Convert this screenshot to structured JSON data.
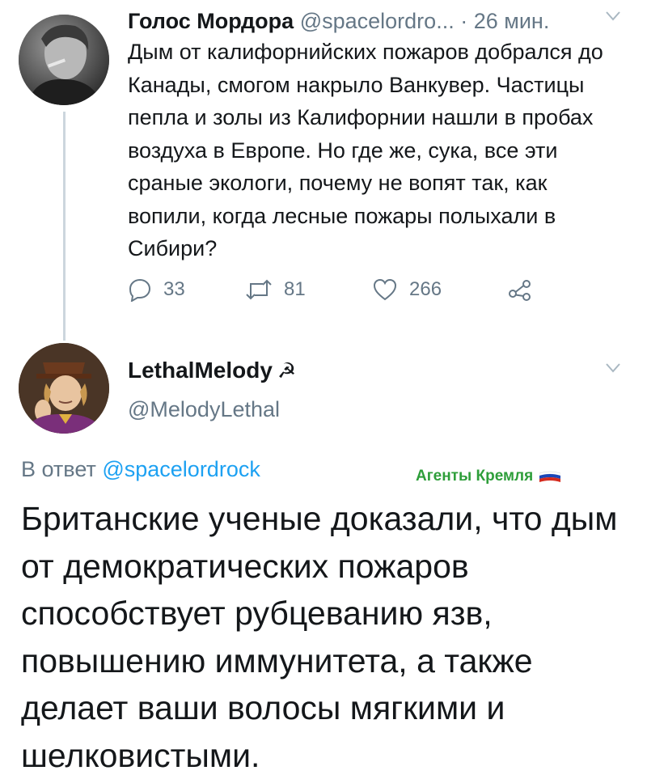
{
  "tweet1": {
    "author_name": "Голос Мордора",
    "author_handle": "@spacelordro...",
    "separator": "·",
    "time": "26 мин.",
    "text": "Дым от калифорнийских пожаров добрался до Канады, смогом накрыло Ванкувер. Частицы пепла и золы из Калифорнии нашли в пробах воздуха в Европе. Но где же, сука, все эти сраные экологи, почему не вопят так, как вопили, когда лесные пожары полыхали в Сибири?",
    "actions": {
      "replies": "33",
      "retweets": "81",
      "likes": "266"
    },
    "icons": [
      "reply-icon",
      "retweet-icon",
      "like-icon",
      "share-icon",
      "chevron-down-icon"
    ]
  },
  "tweet2": {
    "author_name": "LethalMelody",
    "author_symbol": "☭",
    "author_handle": "@MelodyLethal",
    "reply_prefix": "В ответ",
    "reply_handle": "@spacelordrock",
    "label": "Агенты Кремля",
    "label_color": "#2e9e3a",
    "text": "Британские ученые доказали, что дым от демократических пожаров способствует рубцеванию язв, повышению иммунитета, а также делает ваши волосы мягкими и шелковистыми."
  },
  "colors": {
    "secondary_text": "#657786",
    "link": "#1da1f2",
    "thread_line": "#ccd6dd"
  }
}
